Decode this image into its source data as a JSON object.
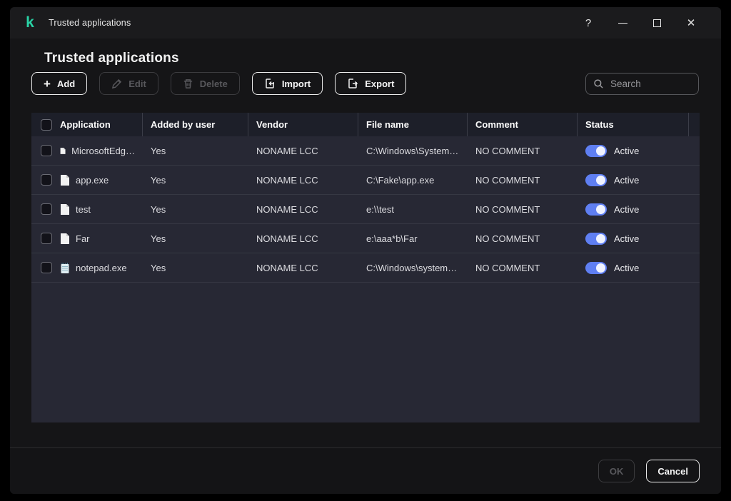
{
  "window": {
    "title": "Trusted applications",
    "controls": {
      "help": "?"
    }
  },
  "page": {
    "title": "Trusted applications"
  },
  "toolbar": {
    "add_label": "Add",
    "edit_label": "Edit",
    "delete_label": "Delete",
    "import_label": "Import",
    "export_label": "Export",
    "search_placeholder": "Search"
  },
  "table": {
    "columns": [
      "Application",
      "Added by user",
      "Vendor",
      "File name",
      "Comment",
      "Status"
    ],
    "rows": [
      {
        "icon": "file-icon",
        "app": "MicrosoftEdg…",
        "added_by_user": "Yes",
        "vendor": "NONAME LCC",
        "file_name": "C:\\Windows\\System…",
        "comment": "NO COMMENT",
        "status_label": "Active",
        "active": true
      },
      {
        "icon": "file-icon",
        "app": "app.exe",
        "added_by_user": "Yes",
        "vendor": "NONAME LCC",
        "file_name": "C:\\Fake\\app.exe",
        "comment": "NO COMMENT",
        "status_label": "Active",
        "active": true
      },
      {
        "icon": "file-icon",
        "app": "test",
        "added_by_user": "Yes",
        "vendor": "NONAME LCC",
        "file_name": "e:\\\\test",
        "comment": "NO COMMENT",
        "status_label": "Active",
        "active": true
      },
      {
        "icon": "file-icon",
        "app": "Far",
        "added_by_user": "Yes",
        "vendor": "NONAME LCC",
        "file_name": "e:\\aaa*b\\Far",
        "comment": "NO COMMENT",
        "status_label": "Active",
        "active": true
      },
      {
        "icon": "notepad-icon",
        "app": "notepad.exe",
        "added_by_user": "Yes",
        "vendor": "NONAME LCC",
        "file_name": "C:\\Windows\\system…",
        "comment": "NO COMMENT",
        "status_label": "Active",
        "active": true
      }
    ]
  },
  "footer": {
    "ok_label": "OK",
    "cancel_label": "Cancel"
  },
  "colors": {
    "accent_teal": "#29d3a6",
    "toggle_on": "#5f7ff2",
    "row_bg": "#272834",
    "header_bg": "#1d1f29"
  }
}
